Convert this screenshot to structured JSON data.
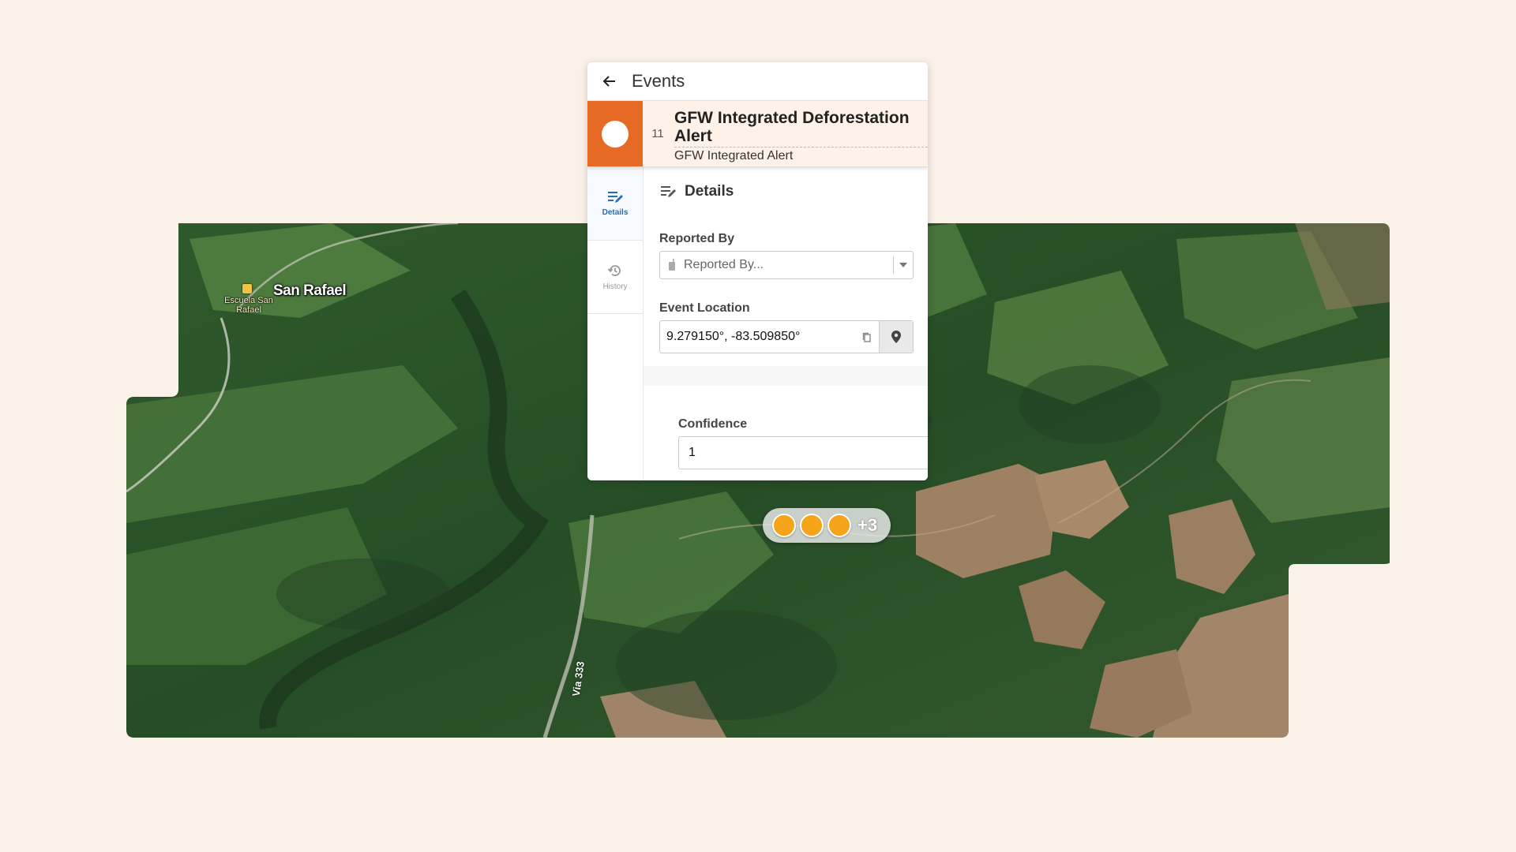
{
  "header": {
    "title": "Events"
  },
  "event": {
    "serial": "11",
    "title": "GFW Integrated Deforestation Alert",
    "subtitle": "GFW Integrated Alert",
    "color": "#e66a24"
  },
  "side_nav": [
    {
      "label": "Details",
      "icon": "details-edit-icon",
      "active": true
    },
    {
      "label": "History",
      "icon": "history-icon",
      "active": false
    }
  ],
  "details": {
    "heading": "Details",
    "reported_by": {
      "label": "Reported By",
      "placeholder": "Reported By..."
    },
    "event_location": {
      "label": "Event Location",
      "value": "9.279150°, -83.509850°"
    },
    "confidence": {
      "label": "Confidence",
      "value": "1"
    }
  },
  "map": {
    "place_label": "San Rafael",
    "school_label": "Escuela San Rafael",
    "road_label": "Via 333",
    "cluster": {
      "more": "+3",
      "color": "#f5a319"
    }
  }
}
